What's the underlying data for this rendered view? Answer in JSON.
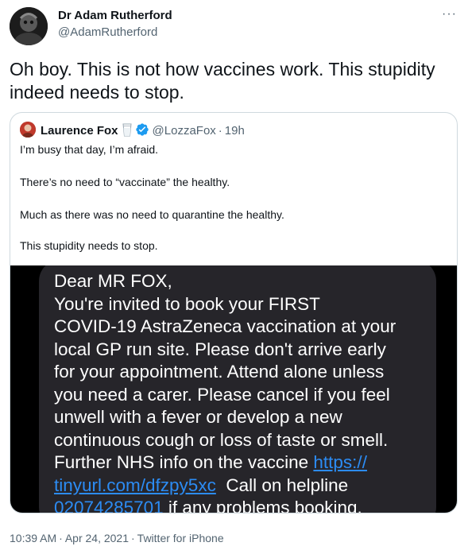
{
  "author": {
    "name": "Dr Adam Rutherford",
    "handle": "@AdamRutherford"
  },
  "more_label": "···",
  "tweet_text": "Oh boy. This is not how vaccines work. This stupidity indeed needs to stop.",
  "quoted": {
    "name": "Laurence Fox",
    "emoji_icon": "milk-glass-icon",
    "verified_icon": "verified-badge-icon",
    "handle": "@LozzaFox",
    "dot": "·",
    "time": "19h",
    "lines": [
      "I’m busy that day, I’m afraid.",
      "There’s no need to “vaccinate” the healthy.",
      "Much as there was no need to quarantine the healthy.",
      "This stupidity needs to stop."
    ],
    "sms": {
      "l1": "Dear MR FOX,",
      "l2": "You're invited to book your FIRST",
      "l3": "COVID-19 AstraZeneca vaccination at your",
      "l4": "local GP run site. Please don't arrive early",
      "l5": "for your appointment. Attend alone unless",
      "l6": "you need a carer. Please cancel if you feel",
      "l7": "unwell with a fever or develop a new",
      "l8": "continuous cough or loss of taste or smell.",
      "l9_text": "Further NHS info on the vaccine ",
      "l9_link": "https://",
      "l10_link": "tinyurl.com/dfzpy5xc",
      "l10_text": "  Call on helpline",
      "l11_link": "02074285701",
      "l11_text": " if any problems booking."
    }
  },
  "footer": {
    "time": "10:39 AM",
    "sep1": "·",
    "date": "Apr 24, 2021",
    "sep2": "·",
    "source": "Twitter for iPhone"
  },
  "colors": {
    "link": "#2c8cf4",
    "verified": "#1d9bf0",
    "secondary_text": "#536471"
  }
}
